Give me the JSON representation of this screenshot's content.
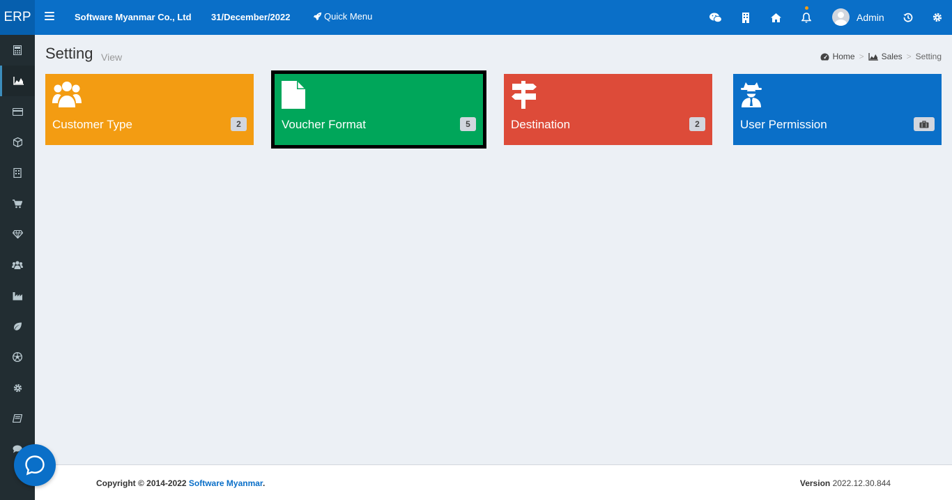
{
  "app": {
    "logo": "ERP"
  },
  "header": {
    "company": "Software Myanmar Co., Ltd",
    "date": "31/December/2022",
    "quick_menu": "Quick Menu",
    "user_name": "Admin",
    "accent_color": "#0a6fc8"
  },
  "sidebar": {
    "items": [
      {
        "icon": "calculator-icon"
      },
      {
        "icon": "area-chart-icon",
        "active": true
      },
      {
        "icon": "credit-card-icon"
      },
      {
        "icon": "cube-icon"
      },
      {
        "icon": "building-icon"
      },
      {
        "icon": "cart-icon"
      },
      {
        "icon": "diamond-icon"
      },
      {
        "icon": "users-icon"
      },
      {
        "icon": "industry-icon"
      },
      {
        "icon": "leaf-icon"
      },
      {
        "icon": "soccer-ball-icon"
      },
      {
        "icon": "gear-icon"
      },
      {
        "icon": "book-icon"
      },
      {
        "icon": "comments-icon"
      }
    ]
  },
  "page": {
    "title": "Setting",
    "subtitle": "View",
    "breadcrumb": {
      "home": "Home",
      "sales": "Sales",
      "current": "Setting",
      "separator": ">"
    }
  },
  "tiles": [
    {
      "label": "Customer Type",
      "badge": "2",
      "color": "#f39c12",
      "icon": "users-icon"
    },
    {
      "label": "Voucher Format",
      "badge": "5",
      "color": "#00a65a",
      "icon": "file-icon",
      "selected": true
    },
    {
      "label": "Destination",
      "badge": "2",
      "color": "#dd4b39",
      "icon": "signpost-icon"
    },
    {
      "label": "User Permission",
      "badge": "",
      "color": "#0a6fc8",
      "icon": "user-secret-icon",
      "badge_icon": "briefcase-icon"
    }
  ],
  "footer": {
    "copyright_prefix": "Copyright © 2014-2022 ",
    "company_link": "Software Myanmar",
    "copyright_suffix": ".",
    "version_label": "Version",
    "version_value": "2022.12.30.844"
  }
}
